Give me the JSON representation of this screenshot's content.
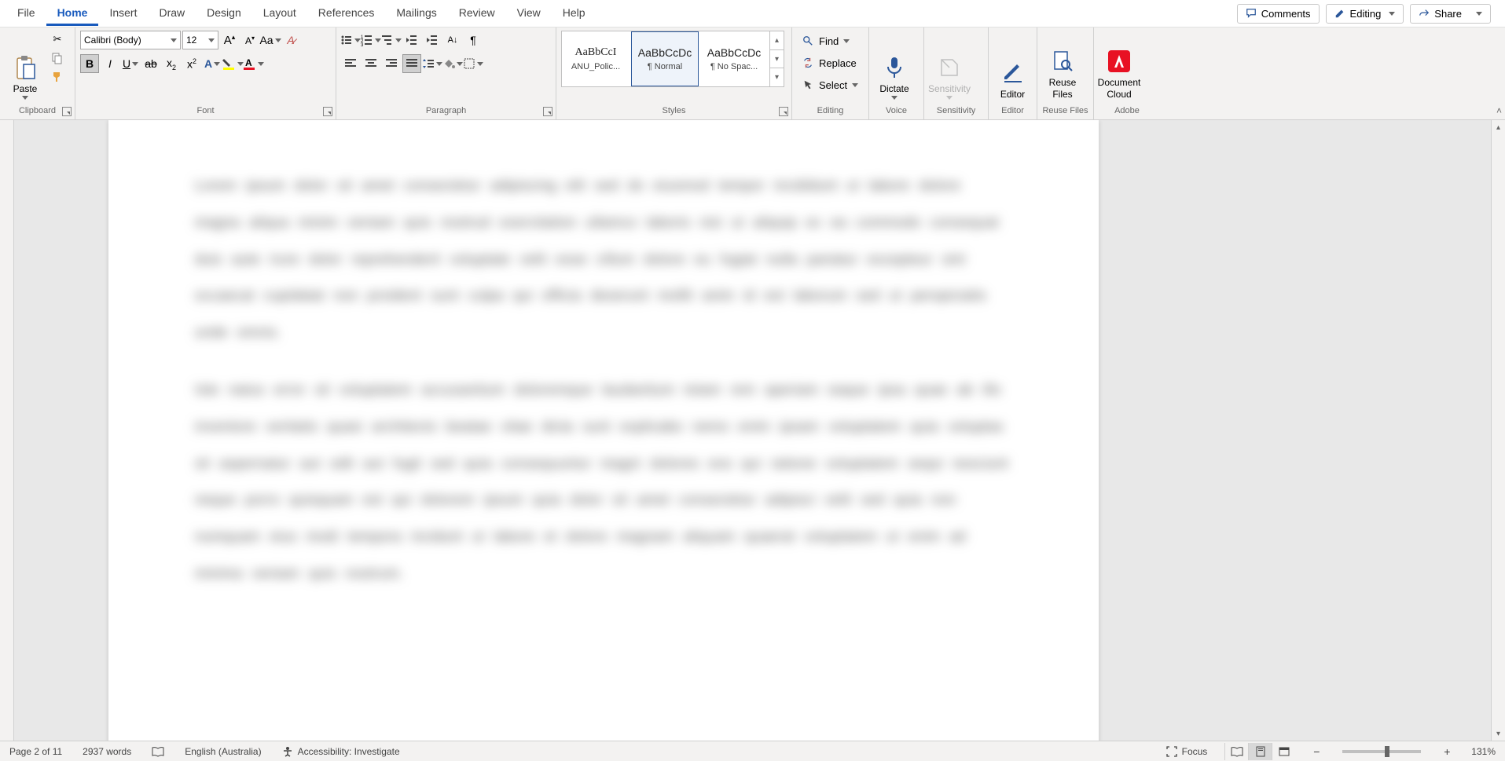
{
  "menu": {
    "tabs": [
      "File",
      "Home",
      "Insert",
      "Draw",
      "Design",
      "Layout",
      "References",
      "Mailings",
      "Review",
      "View",
      "Help"
    ],
    "active": "Home",
    "comments": "Comments",
    "editing": "Editing",
    "share": "Share"
  },
  "ribbon": {
    "clipboard": {
      "paste": "Paste",
      "label": "Clipboard"
    },
    "font": {
      "label": "Font",
      "name": "Calibri (Body)",
      "size": "12"
    },
    "paragraph": {
      "label": "Paragraph"
    },
    "styles": {
      "label": "Styles",
      "items": [
        {
          "preview": "AaBbCcI",
          "name": "ANU_Polic..."
        },
        {
          "preview": "AaBbCcDc",
          "name": "¶ Normal"
        },
        {
          "preview": "AaBbCcDc",
          "name": "¶ No Spac..."
        }
      ],
      "selected": 1
    },
    "editing": {
      "label": "Editing",
      "find": "Find",
      "replace": "Replace",
      "select": "Select"
    },
    "voice": {
      "label": "Voice",
      "dictate": "Dictate"
    },
    "sensitivity": {
      "label": "Sensitivity",
      "btn": "Sensitivity"
    },
    "editor": {
      "label": "Editor",
      "btn": "Editor"
    },
    "reuse": {
      "label": "Reuse Files",
      "btn": "Reuse\nFiles"
    },
    "adobe": {
      "label": "Adobe",
      "btn": "Document\nCloud"
    }
  },
  "status": {
    "page": "Page 2 of 11",
    "words": "2937 words",
    "lang": "English (Australia)",
    "a11y": "Accessibility: Investigate",
    "focus": "Focus",
    "zoom": "131%"
  }
}
